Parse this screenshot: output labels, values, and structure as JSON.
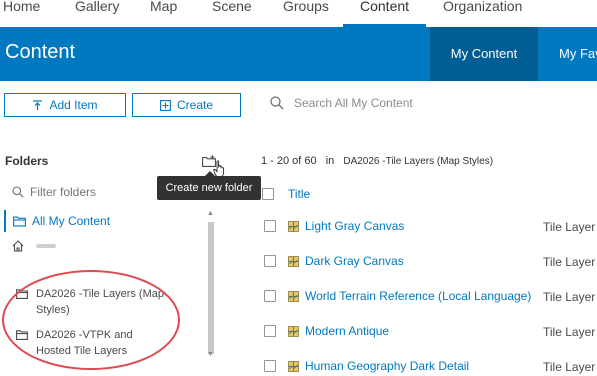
{
  "topnav": {
    "tabs": [
      {
        "label": "Home"
      },
      {
        "label": "Gallery"
      },
      {
        "label": "Map"
      },
      {
        "label": "Scene"
      },
      {
        "label": "Groups"
      },
      {
        "label": "Content"
      },
      {
        "label": "Organization"
      }
    ],
    "active": "Content"
  },
  "banner": {
    "title": "Content",
    "tab_my_content": "My Content",
    "tab_my_favorites": "My Fav"
  },
  "actions": {
    "add_item": "Add Item",
    "create": "Create",
    "search_placeholder": "Search All My Content"
  },
  "folders": {
    "heading": "Folders",
    "tooltip": "Create new folder",
    "filter_placeholder": "Filter folders",
    "all_label": "All My Content",
    "items": [
      {
        "label": "DA2026 -Tile Layers (Map Styles)"
      },
      {
        "label": "DA2026 -VTPK and Hosted Tile Layers"
      }
    ]
  },
  "list": {
    "range": "1 - 20 of 60",
    "in_label": "in",
    "folder_name": "DA2026 -Tile Layers (Map Styles)",
    "column_title": "Title",
    "rows": [
      {
        "title": "Light Gray Canvas",
        "type": "Tile Layer"
      },
      {
        "title": "Dark Gray Canvas",
        "type": "Tile Layer"
      },
      {
        "title": "World Terrain Reference (Local Language)",
        "type": "Tile Layer"
      },
      {
        "title": "Modern Antique",
        "type": "Tile Layer"
      },
      {
        "title": "Human Geography Dark Detail",
        "type": "Tile Layer"
      }
    ]
  },
  "colors": {
    "brand_blue": "#0079c1",
    "banner_active": "#005e95",
    "annotation_red": "#e0484c"
  }
}
